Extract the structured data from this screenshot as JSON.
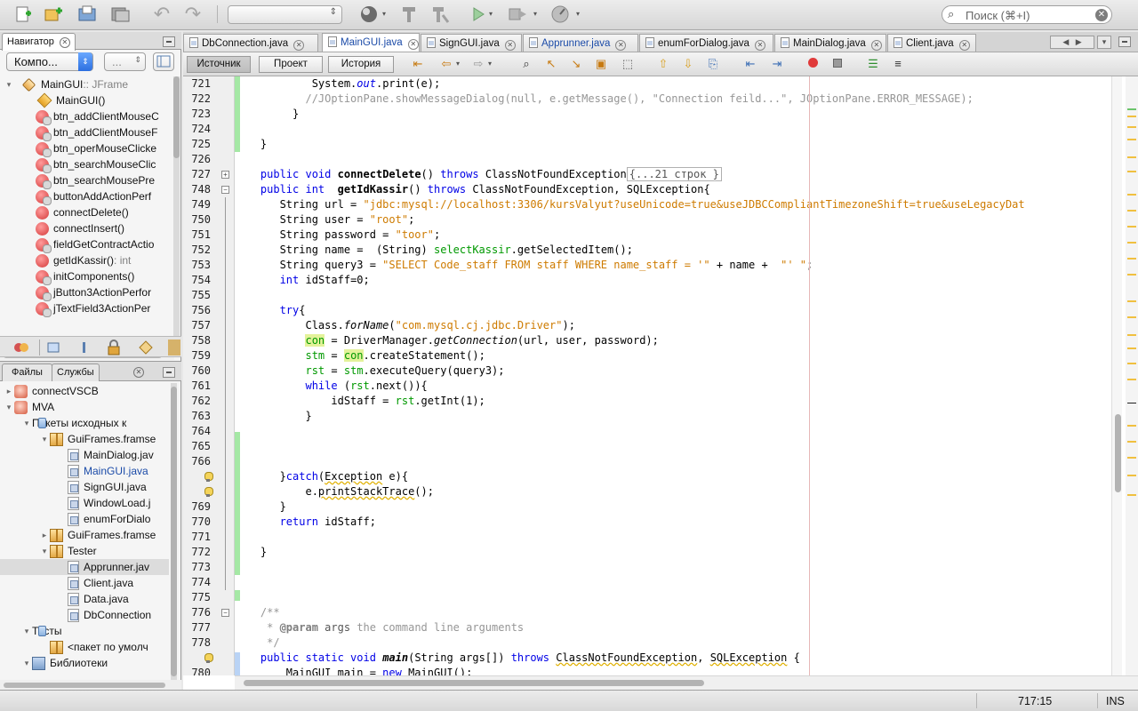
{
  "toolbar": {
    "search_placeholder": "Поиск (⌘+I)"
  },
  "navigator": {
    "tab_label": "Навигатор",
    "filter_value": "Компо...",
    "filter2_value": "...",
    "items": [
      {
        "label": "MainGUI",
        "sub": " :: JFrame",
        "icon": "class-icon",
        "level": 0,
        "toggle": "▾"
      },
      {
        "label": "MainGUI()",
        "sub": "",
        "icon": "constructor-icon",
        "level": 1
      },
      {
        "label": "btn_addClientMouseC",
        "sub": "",
        "icon": "method-icon",
        "level": 1
      },
      {
        "label": "btn_addClientMouseF",
        "sub": "",
        "icon": "method-icon",
        "level": 1
      },
      {
        "label": "btn_operMouseClicke",
        "sub": "",
        "icon": "method-icon",
        "level": 1
      },
      {
        "label": "btn_searchMouseClic",
        "sub": "",
        "icon": "method-icon",
        "level": 1
      },
      {
        "label": "btn_searchMousePre",
        "sub": "",
        "icon": "method-icon",
        "level": 1
      },
      {
        "label": "buttonAddActionPerf",
        "sub": "",
        "icon": "method-icon",
        "level": 1
      },
      {
        "label": "connectDelete()",
        "sub": "",
        "icon": "method-public-icon",
        "level": 1
      },
      {
        "label": "connectInsert()",
        "sub": "",
        "icon": "method-public-icon",
        "level": 1
      },
      {
        "label": "fieldGetContractActio",
        "sub": "",
        "icon": "method-icon",
        "level": 1
      },
      {
        "label": "getIdKassir()",
        "sub": " : int",
        "icon": "method-public-icon",
        "level": 1
      },
      {
        "label": "initComponents()",
        "sub": "",
        "icon": "method-icon",
        "level": 1
      },
      {
        "label": "jButton3ActionPerfor",
        "sub": "",
        "icon": "method-icon",
        "level": 1
      },
      {
        "label": "jTextField3ActionPer",
        "sub": "",
        "icon": "method-icon",
        "level": 1
      }
    ]
  },
  "projects": {
    "tab_files": "Файлы",
    "tab_services": "Службы",
    "items": [
      {
        "label": "connectVSCB",
        "icon": "project-icon",
        "level": 0,
        "toggle": "▸"
      },
      {
        "label": "MVA",
        "icon": "project-icon",
        "level": 0,
        "toggle": "▾"
      },
      {
        "label": "Пакеты исходных к",
        "icon": "folder-icon",
        "level": 1,
        "toggle": "▾"
      },
      {
        "label": "GuiFrames.framse",
        "icon": "package-icon",
        "level": 2,
        "toggle": "▾"
      },
      {
        "label": "MainDialog.jav",
        "icon": "java-file-icon",
        "level": 3,
        "toggle": ""
      },
      {
        "label": "MainGUI.java",
        "icon": "java-file-icon",
        "level": 3,
        "toggle": "",
        "current": true
      },
      {
        "label": "SignGUI.java",
        "icon": "java-file-icon",
        "level": 3,
        "toggle": ""
      },
      {
        "label": "WindowLoad.j",
        "icon": "java-file-icon",
        "level": 3,
        "toggle": ""
      },
      {
        "label": "enumForDialo",
        "icon": "java-file-icon",
        "level": 3,
        "toggle": ""
      },
      {
        "label": "GuiFrames.framse",
        "icon": "package-icon",
        "level": 2,
        "toggle": "▸"
      },
      {
        "label": "Tester",
        "icon": "package-icon",
        "level": 2,
        "toggle": "▾"
      },
      {
        "label": "Apprunner.jav",
        "icon": "java-file-icon",
        "level": 3,
        "toggle": "",
        "selected": true
      },
      {
        "label": "Client.java",
        "icon": "java-file-icon",
        "level": 3,
        "toggle": ""
      },
      {
        "label": "Data.java",
        "icon": "java-file-icon",
        "level": 3,
        "toggle": ""
      },
      {
        "label": "DbConnection",
        "icon": "java-file-icon",
        "level": 3,
        "toggle": ""
      },
      {
        "label": "Тесты",
        "icon": "folder-icon",
        "level": 1,
        "toggle": "▾"
      },
      {
        "label": "<пакет по умолч",
        "icon": "package-icon",
        "level": 2,
        "toggle": ""
      },
      {
        "label": "Библиотеки",
        "icon": "library-icon",
        "level": 1,
        "toggle": "▾"
      }
    ]
  },
  "editor": {
    "tabs": [
      {
        "label": "DbConnection.java",
        "active": false
      },
      {
        "label": "MainGUI.java",
        "active": true
      },
      {
        "label": "SignGUI.java",
        "active": false
      },
      {
        "label": "Apprunner.java",
        "active": false
      },
      {
        "label": "enumForDialog.java",
        "active": false
      },
      {
        "label": "MainDialog.java",
        "active": false
      },
      {
        "label": "Client.java",
        "active": false
      }
    ],
    "view_source": "Источник",
    "view_design": "Проект",
    "view_history": "История",
    "line_numbers": [
      "721",
      "722",
      "723",
      "724",
      "725",
      "726",
      "727",
      "748",
      "749",
      "750",
      "751",
      "752",
      "753",
      "754",
      "755",
      "756",
      "757",
      "758",
      "759",
      "760",
      "761",
      "762",
      "763",
      "764",
      "765",
      "766",
      "",
      "",
      "769",
      "770",
      "771",
      "772",
      "773",
      "774",
      "775",
      "776",
      "777",
      "778",
      "",
      "780"
    ],
    "fold_text": "{...21 строк }"
  },
  "status": {
    "position": "717:15",
    "mode": "INS"
  }
}
